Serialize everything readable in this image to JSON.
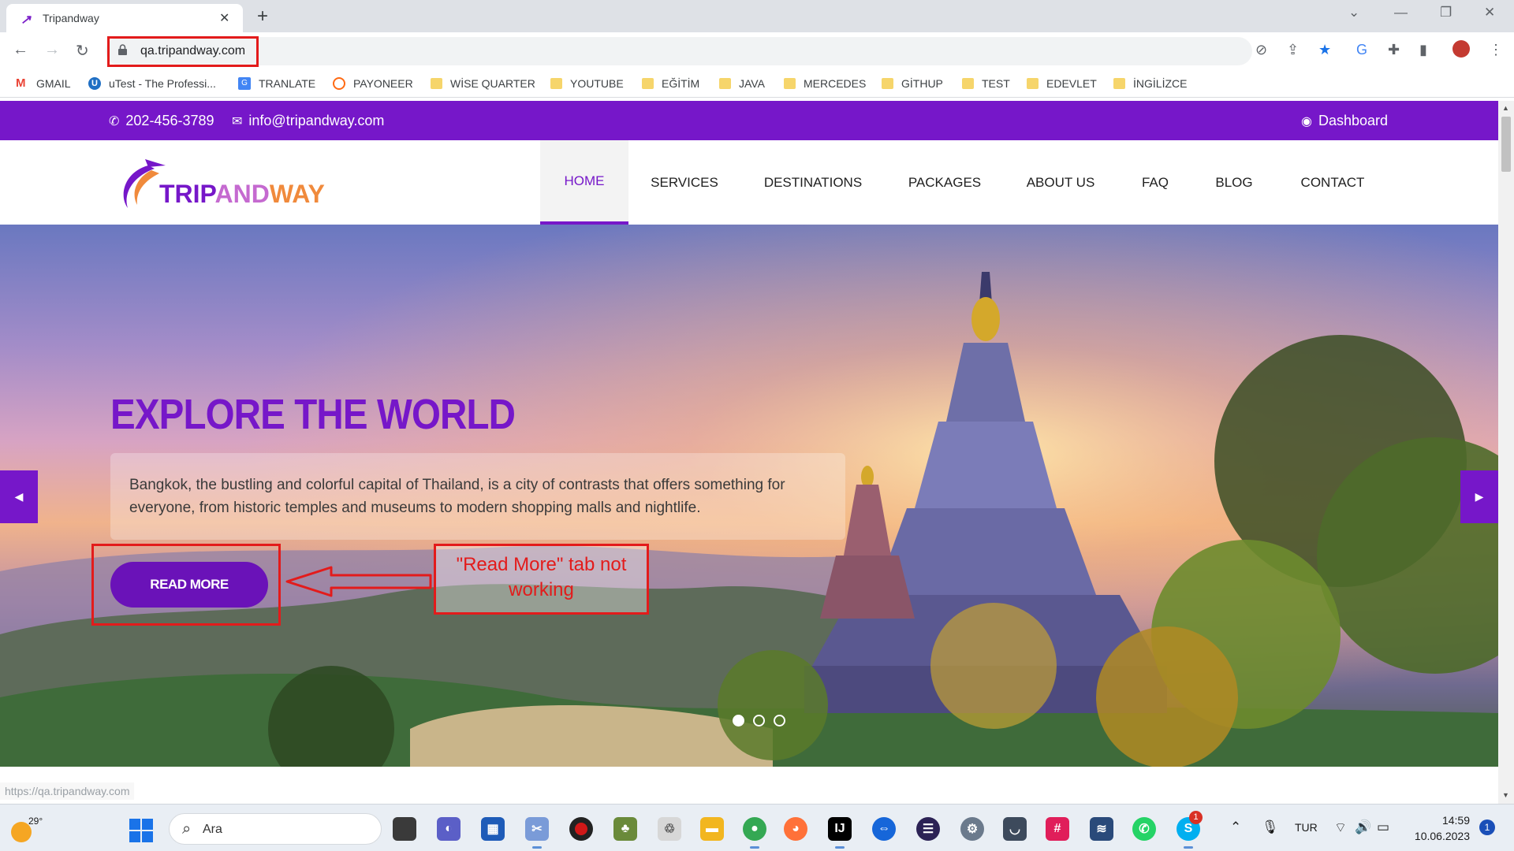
{
  "browser": {
    "tab_title": "Tripandway",
    "url": "qa.tripandway.com",
    "status_url": "https://qa.tripandway.com"
  },
  "bookmarks": [
    {
      "label": "GMAIL",
      "icon": "gmail-icon"
    },
    {
      "label": "uTest - The Professi...",
      "icon": "utest-icon"
    },
    {
      "label": "TRANLATE",
      "icon": "translate-icon"
    },
    {
      "label": "PAYONEER",
      "icon": "payoneer-icon"
    },
    {
      "label": "WİSE QUARTER",
      "icon": "folder-icon"
    },
    {
      "label": "YOUTUBE",
      "icon": "folder-icon"
    },
    {
      "label": "EĞİTİM",
      "icon": "folder-icon"
    },
    {
      "label": "JAVA",
      "icon": "folder-icon"
    },
    {
      "label": "MERCEDES",
      "icon": "folder-icon"
    },
    {
      "label": "GİTHUP",
      "icon": "folder-icon"
    },
    {
      "label": "TEST",
      "icon": "folder-icon"
    },
    {
      "label": "EDEVLET",
      "icon": "folder-icon"
    },
    {
      "label": "İNGİLİZCE",
      "icon": "folder-icon"
    }
  ],
  "site": {
    "phone": "202-456-3789",
    "email": "info@tripandway.com",
    "dashboard_label": "Dashboard",
    "logo": {
      "part1": "TRIP",
      "part2": "AND",
      "part3": "WAY"
    },
    "nav": [
      "HOME",
      "SERVICES",
      "DESTINATIONS",
      "PACKAGES",
      "ABOUT US",
      "FAQ",
      "BLOG",
      "CONTACT"
    ],
    "active_nav": "HOME",
    "hero": {
      "title": "EXPLORE THE WORLD",
      "description": "Bangkok, the bustling and colorful capital of Thailand, is a city of contrasts that offers something for everyone, from historic temples and museums to modern shopping malls and nightlife.",
      "button": "READ MORE",
      "slides_total": 3,
      "active_slide": 1
    }
  },
  "annotation": {
    "note": "\"Read More\" tab not working"
  },
  "taskbar": {
    "temperature": "29°",
    "search_placeholder": "Ara",
    "language": "TUR",
    "time": "14:59",
    "date": "10.06.2023",
    "notification_count": "1",
    "skype_badge": "1"
  },
  "colors": {
    "brand": "#7617c9",
    "annotation": "#e31b1b"
  }
}
